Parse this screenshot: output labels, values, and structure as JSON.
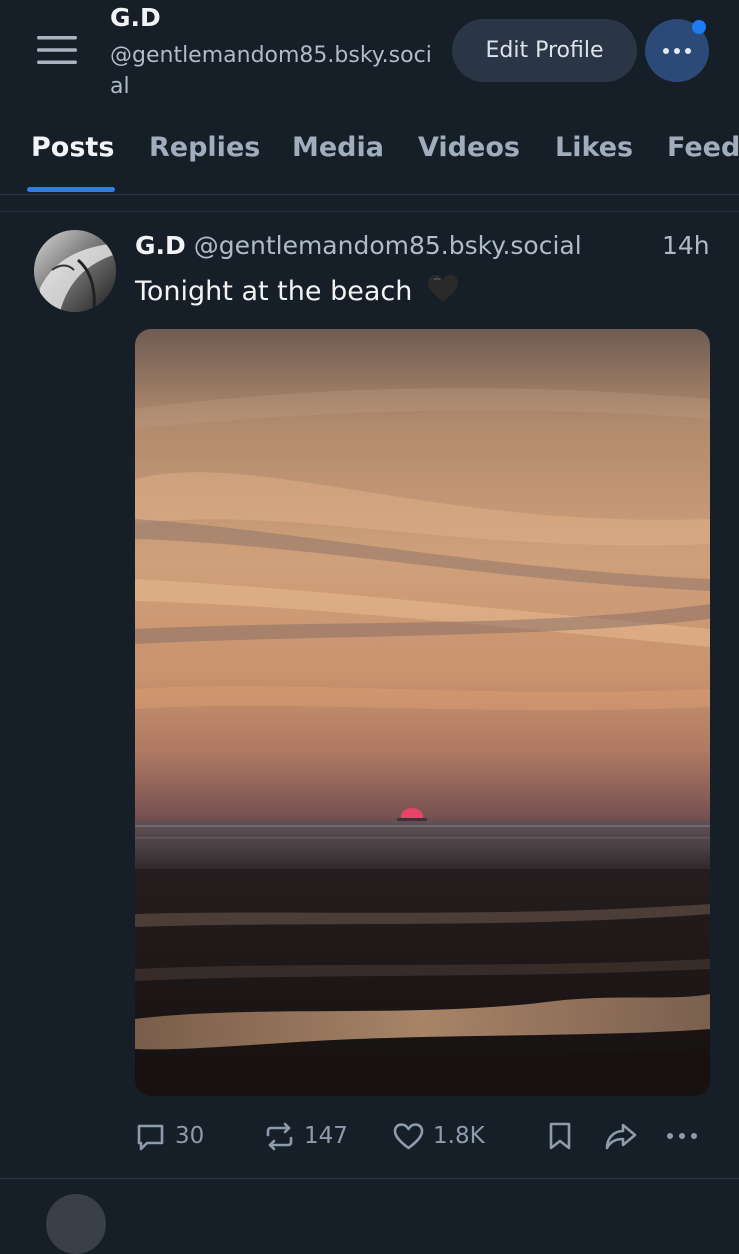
{
  "header": {
    "menu_icon": "hamburger-menu-icon",
    "name": "G.D",
    "handle": "@gentlemandom85.bsky.social",
    "edit_profile_label": "Edit Profile",
    "more_icon": "ellipsis-icon"
  },
  "tabs": [
    {
      "label": "Posts",
      "active": true
    },
    {
      "label": "Replies",
      "active": false
    },
    {
      "label": "Media",
      "active": false
    },
    {
      "label": "Videos",
      "active": false
    },
    {
      "label": "Likes",
      "active": false
    },
    {
      "label": "Feeds",
      "active": false
    }
  ],
  "post": {
    "author": "G.D",
    "handle": "@gentlemandom85.bsky.social",
    "time": "14h",
    "text": "Tonight at the beach",
    "emoji": "black-heart",
    "replies": "30",
    "reposts": "147",
    "likes": "1.8K"
  },
  "colors": {
    "background": "#161e27",
    "accent": "#2f7bf4",
    "muted_text": "#8d9cad",
    "button_bg": "#2a3645"
  }
}
